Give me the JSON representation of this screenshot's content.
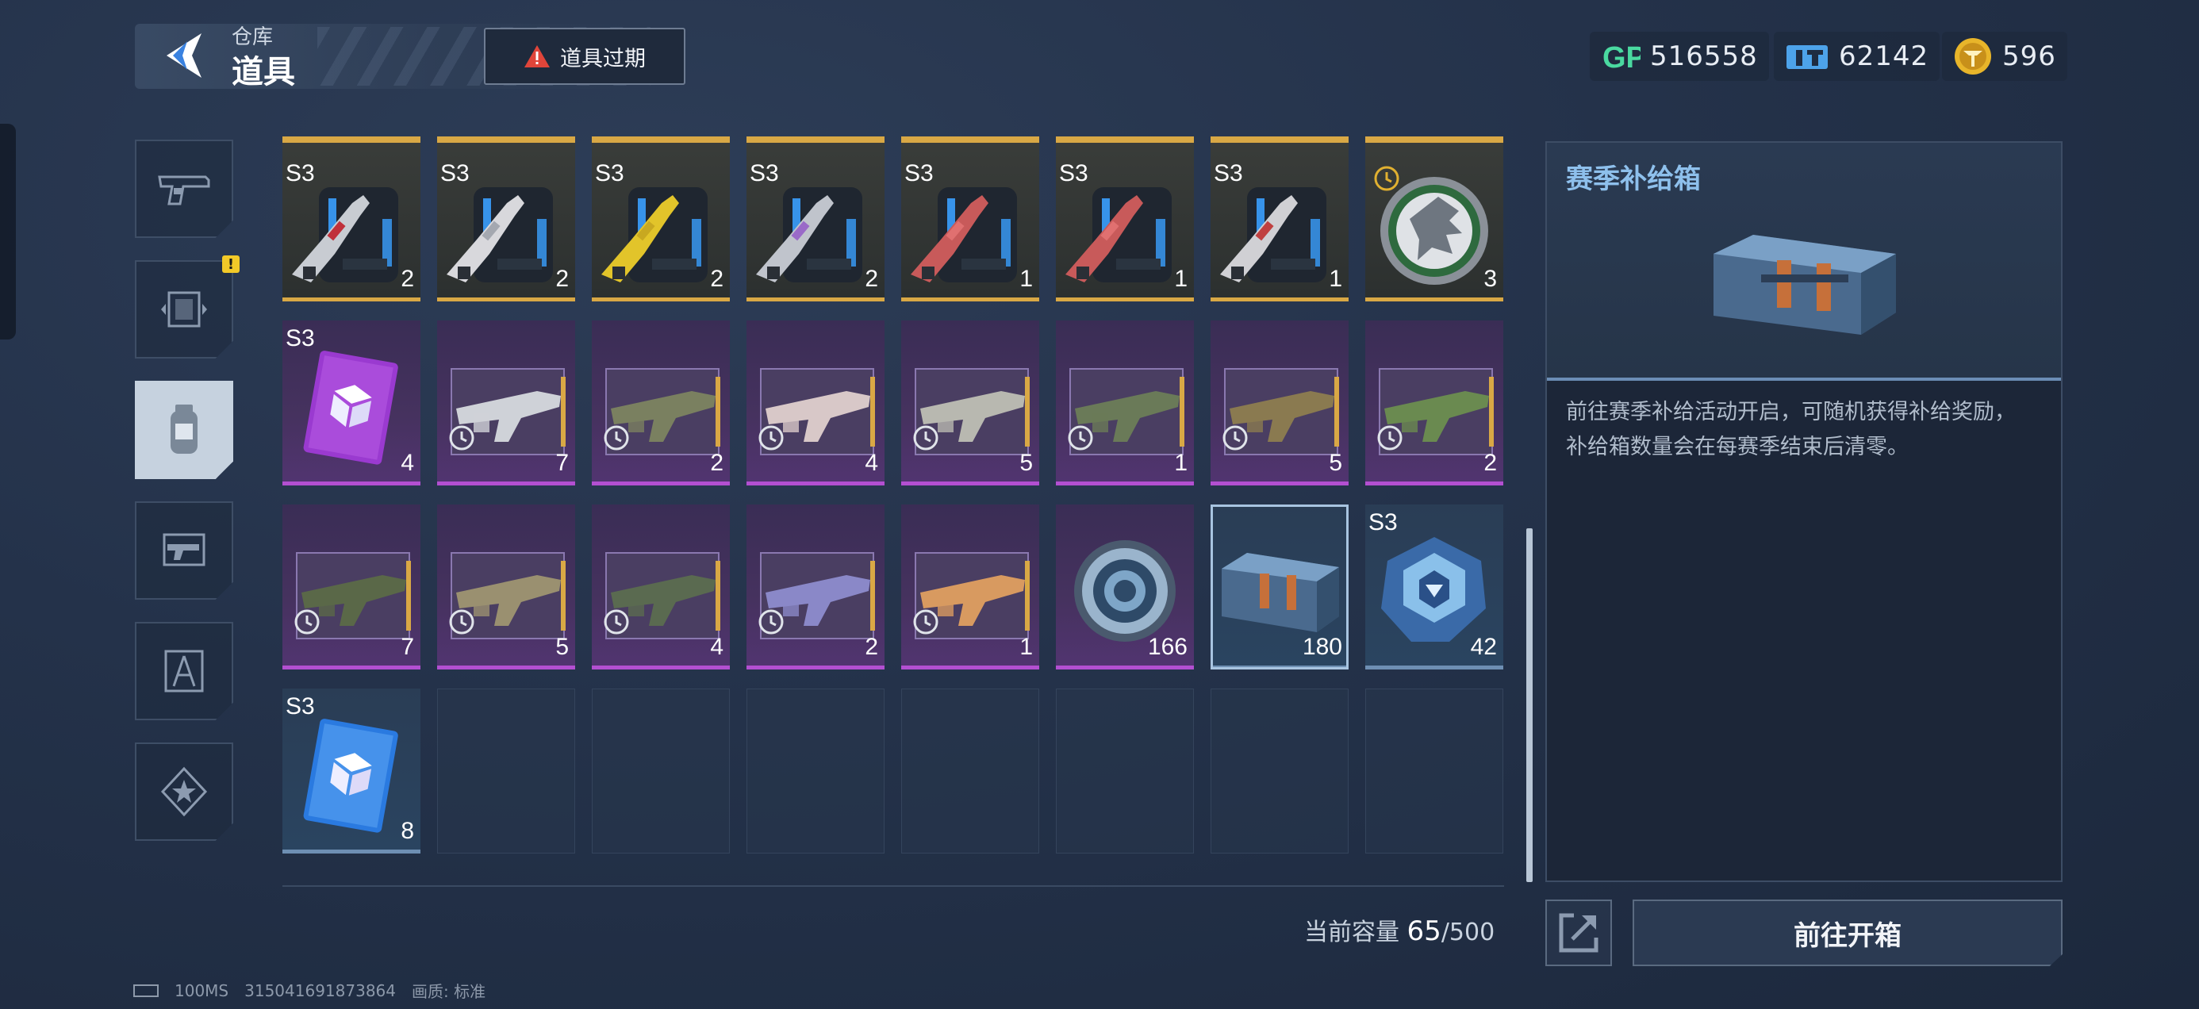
{
  "header": {
    "subtitle": "仓库",
    "title": "道具",
    "expire_label": "道具过期"
  },
  "currencies": [
    {
      "icon": "gp-icon",
      "label": "GP",
      "value": "516558"
    },
    {
      "icon": "ticket-icon",
      "value": "62142"
    },
    {
      "icon": "coin-icon",
      "value": "596"
    }
  ],
  "side_tabs": [
    {
      "name": "pistol",
      "icon": "pistol-icon"
    },
    {
      "name": "frame",
      "icon": "frame-icon",
      "badge": "!"
    },
    {
      "name": "items",
      "icon": "grenade-icon",
      "active": true
    },
    {
      "name": "gun-skin",
      "icon": "gun-card-icon"
    },
    {
      "name": "blueprint",
      "icon": "compass-icon"
    },
    {
      "name": "star",
      "icon": "star-icon"
    }
  ],
  "items": [
    {
      "rarity": "gold",
      "tag": "S3",
      "qty": "2",
      "icon": "weapon-crate-icon",
      "tint": "#3aa0ff",
      "gun": "#c8ccd2",
      "accent": "#c0303a"
    },
    {
      "rarity": "gold",
      "tag": "S3",
      "qty": "2",
      "icon": "weapon-crate-icon",
      "tint": "#3aa0ff",
      "gun": "#d8d8dc",
      "accent": "#a4a8b0"
    },
    {
      "rarity": "gold",
      "tag": "S3",
      "qty": "2",
      "icon": "weapon-crate-icon",
      "tint": "#3aa0ff",
      "gun": "#e2c42a",
      "accent": "#c8a820"
    },
    {
      "rarity": "gold",
      "tag": "S3",
      "qty": "2",
      "icon": "weapon-crate-icon",
      "tint": "#3aa0ff",
      "gun": "#c0c4cc",
      "accent": "#9a6ac8"
    },
    {
      "rarity": "gold",
      "tag": "S3",
      "qty": "1",
      "icon": "weapon-crate-icon",
      "tint": "#3aa0ff",
      "gun": "#c85a5a",
      "accent": "#e07070"
    },
    {
      "rarity": "gold",
      "tag": "S3",
      "qty": "1",
      "icon": "weapon-crate-icon",
      "tint": "#3aa0ff",
      "gun": "#c85a5a",
      "accent": "#e07070"
    },
    {
      "rarity": "gold",
      "tag": "S3",
      "qty": "1",
      "icon": "weapon-crate-icon",
      "tint": "#3aa0ff",
      "gun": "#d0d0d4",
      "accent": "#c04040"
    },
    {
      "rarity": "gold",
      "tag": "",
      "qty": "3",
      "icon": "wolf-emblem-icon",
      "clock": true
    },
    {
      "rarity": "purple",
      "tag": "S3",
      "qty": "4",
      "icon": "supply-card-purple-icon"
    },
    {
      "rarity": "purple",
      "tag": "",
      "qty": "7",
      "icon": "gun-skin-card-icon",
      "clock": true,
      "gun": "#cfd2d8"
    },
    {
      "rarity": "purple",
      "tag": "",
      "qty": "2",
      "icon": "gun-skin-card-icon",
      "clock": true,
      "gun": "#7a8060"
    },
    {
      "rarity": "purple",
      "tag": "",
      "qty": "4",
      "icon": "gun-skin-card-icon",
      "clock": true,
      "gun": "#d8c8c8"
    },
    {
      "rarity": "purple",
      "tag": "",
      "qty": "5",
      "icon": "gun-skin-card-icon",
      "clock": true,
      "gun": "#b8b8b0"
    },
    {
      "rarity": "purple",
      "tag": "",
      "qty": "1",
      "icon": "gun-skin-card-icon",
      "clock": true,
      "gun": "#6a7a58"
    },
    {
      "rarity": "purple",
      "tag": "",
      "qty": "5",
      "icon": "gun-skin-card-icon",
      "clock": true,
      "gun": "#8a7a50"
    },
    {
      "rarity": "purple",
      "tag": "",
      "qty": "2",
      "icon": "gun-skin-card-icon",
      "clock": true,
      "gun": "#6a8a50"
    },
    {
      "rarity": "purple",
      "tag": "",
      "qty": "7",
      "icon": "gun-skin-card-icon",
      "clock": true,
      "gun": "#5a6848"
    },
    {
      "rarity": "purple",
      "tag": "",
      "qty": "5",
      "icon": "gun-skin-card-icon",
      "clock": true,
      "gun": "#9a9070"
    },
    {
      "rarity": "purple",
      "tag": "",
      "qty": "4",
      "icon": "gun-skin-card-icon",
      "clock": true,
      "gun": "#5a6a50"
    },
    {
      "rarity": "purple",
      "tag": "",
      "qty": "2",
      "icon": "gun-skin-card-icon",
      "clock": true,
      "gun": "#8a88c8"
    },
    {
      "rarity": "purple",
      "tag": "",
      "qty": "1",
      "icon": "gun-skin-card-icon",
      "clock": true,
      "gun": "#d89a60"
    },
    {
      "rarity": "purple",
      "tag": "",
      "qty": "166",
      "icon": "ring-token-icon"
    },
    {
      "rarity": "blue",
      "tag": "",
      "qty": "180",
      "icon": "supply-box-icon",
      "selected": true
    },
    {
      "rarity": "blue",
      "tag": "S3",
      "qty": "42",
      "icon": "crystal-core-icon"
    },
    {
      "rarity": "blue",
      "tag": "S3",
      "qty": "8",
      "icon": "supply-card-blue-icon"
    },
    {
      "rarity": "empty"
    },
    {
      "rarity": "empty"
    },
    {
      "rarity": "empty"
    },
    {
      "rarity": "empty"
    },
    {
      "rarity": "empty"
    },
    {
      "rarity": "empty"
    },
    {
      "rarity": "empty"
    }
  ],
  "capacity": {
    "label": "当前容量",
    "current": "65",
    "max": "/500"
  },
  "detail": {
    "title": "赛季补给箱",
    "description_line1": "前往赛季补给活动开启，可随机获得补给奖励，",
    "description_line2": "补给箱数量会在每赛季结束后清零。",
    "open_label": "前往开箱"
  },
  "footer": {
    "ping": "100MS",
    "uid": "315041691873864",
    "quality": "画质:  标准"
  },
  "colors": {
    "gold": "#d9a845",
    "purple": "#b34fd1",
    "blue_border": "#6e8fb3",
    "title_blue": "#8ec0ec"
  }
}
